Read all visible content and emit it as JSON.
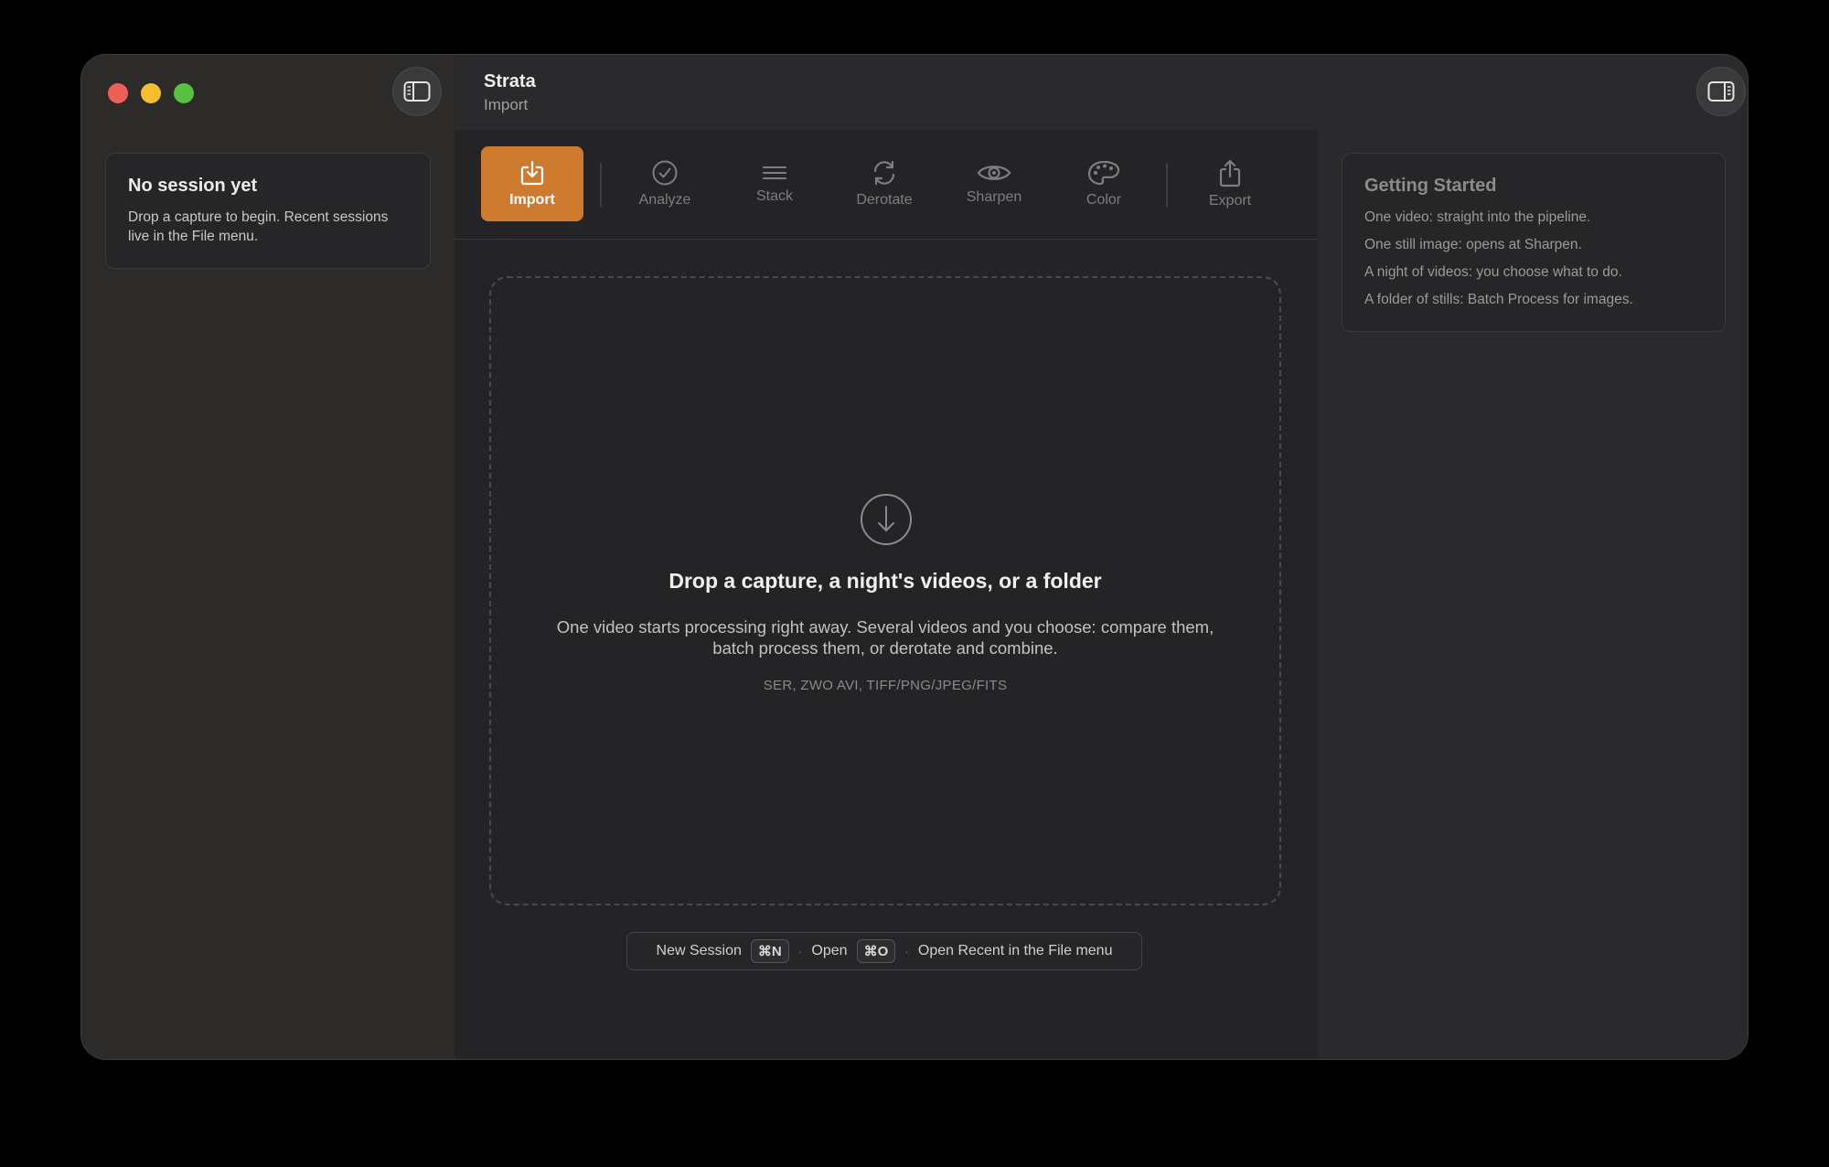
{
  "app": {
    "title": "Strata",
    "subtitle": "Import"
  },
  "left_panel": {
    "heading": "No session yet",
    "body": "Drop a capture to begin. Recent sessions live in the File menu."
  },
  "toolbar": {
    "items": [
      {
        "label": "Import",
        "icon": "import-icon",
        "active": true
      },
      {
        "label": "Analyze",
        "icon": "checkmark-circle-icon"
      },
      {
        "label": "Stack",
        "icon": "stack-lines-icon"
      },
      {
        "label": "Derotate",
        "icon": "rotate-arrows-icon"
      },
      {
        "label": "Sharpen",
        "icon": "eye-icon"
      },
      {
        "label": "Color",
        "icon": "palette-icon"
      },
      {
        "label": "Export",
        "icon": "share-icon"
      }
    ]
  },
  "dropzone": {
    "title": "Drop a capture, a night's videos, or a folder",
    "body": "One video starts processing right away. Several videos and you choose: compare them, batch process them, or derotate and combine.",
    "formats": "SER, ZWO AVI, TIFF/PNG/JPEG/FITS"
  },
  "shortcuts": {
    "new_label": "New Session",
    "new_key": "⌘N",
    "sep": "·",
    "open_label": "Open",
    "open_key": "⌘O",
    "recent_label": "Open Recent in the File menu"
  },
  "getting_started": {
    "heading": "Getting Started",
    "items": [
      "One video: straight into the pipeline.",
      "One still image: opens at Sharpen.",
      "A night of videos: you choose what to do.",
      "A folder of stills: Batch Process for images."
    ]
  },
  "colors": {
    "accent": "#cf7b2f",
    "window_bg": "#2a2a2c"
  }
}
